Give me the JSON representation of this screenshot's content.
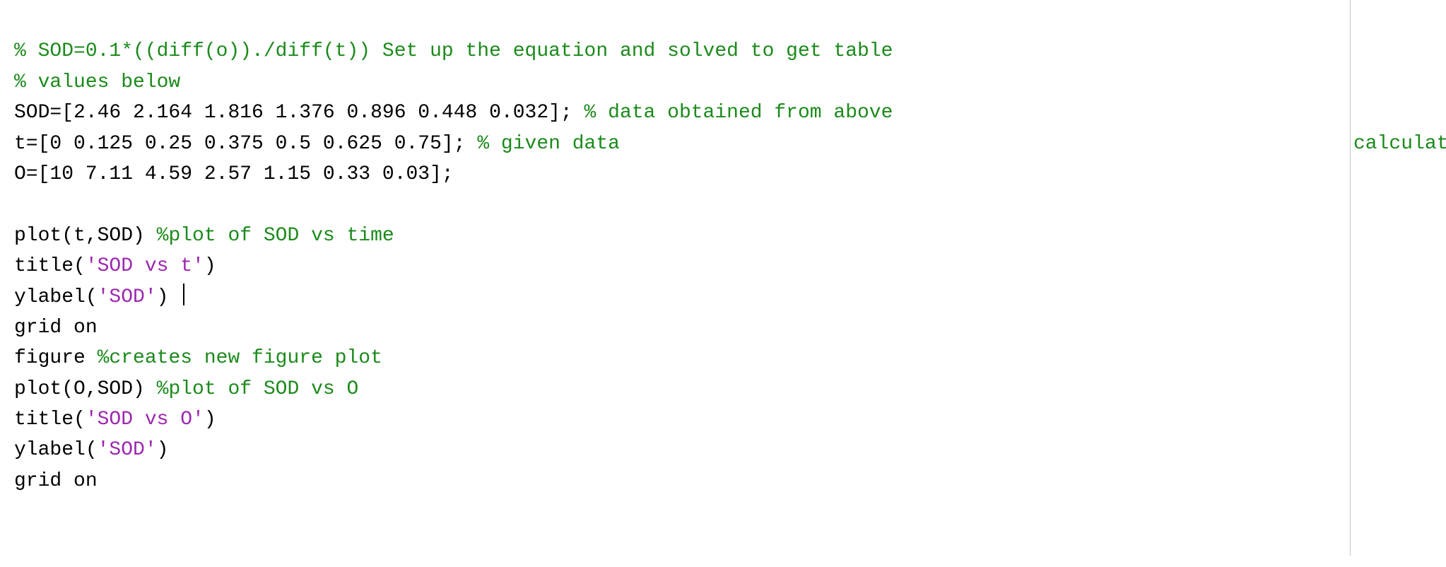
{
  "lines": {
    "l1_comment": "% SOD=0.1*((diff(o))./diff(t)) Set up the equation and solved to get table",
    "l2_comment": "% values below",
    "l3_code": "SOD=[2.46 2.164 1.816 1.376 0.896 0.448 0.032]; ",
    "l3_comment": "% data obtained from above ",
    "l3_overflow": "calculation",
    "l4_code": "t=[0 0.125 0.25 0.375 0.5 0.625 0.75]; ",
    "l4_comment": "% given data",
    "l5_code": "O=[10 7.11 4.59 2.57 1.15 0.33 0.03];",
    "l6_blank": "",
    "l7_code": "plot(t,SOD) ",
    "l7_comment": "%plot of SOD vs time",
    "l8_pre": "title(",
    "l8_str": "'SOD vs t'",
    "l8_post": ")",
    "l9_pre": "ylabel(",
    "l9_str": "'SOD'",
    "l9_post": ") ",
    "l10_code": "grid ",
    "l10_kw": "on",
    "l11_code": "figure ",
    "l11_comment": "%creates new figure plot",
    "l12_code": "plot(O,SOD) ",
    "l12_comment": "%plot of SOD vs O",
    "l13_pre": "title(",
    "l13_str": "'SOD vs O'",
    "l13_post": ")",
    "l14_pre": "ylabel(",
    "l14_str": "'SOD'",
    "l14_post": ")",
    "l15_code": "grid ",
    "l15_kw": "on"
  }
}
